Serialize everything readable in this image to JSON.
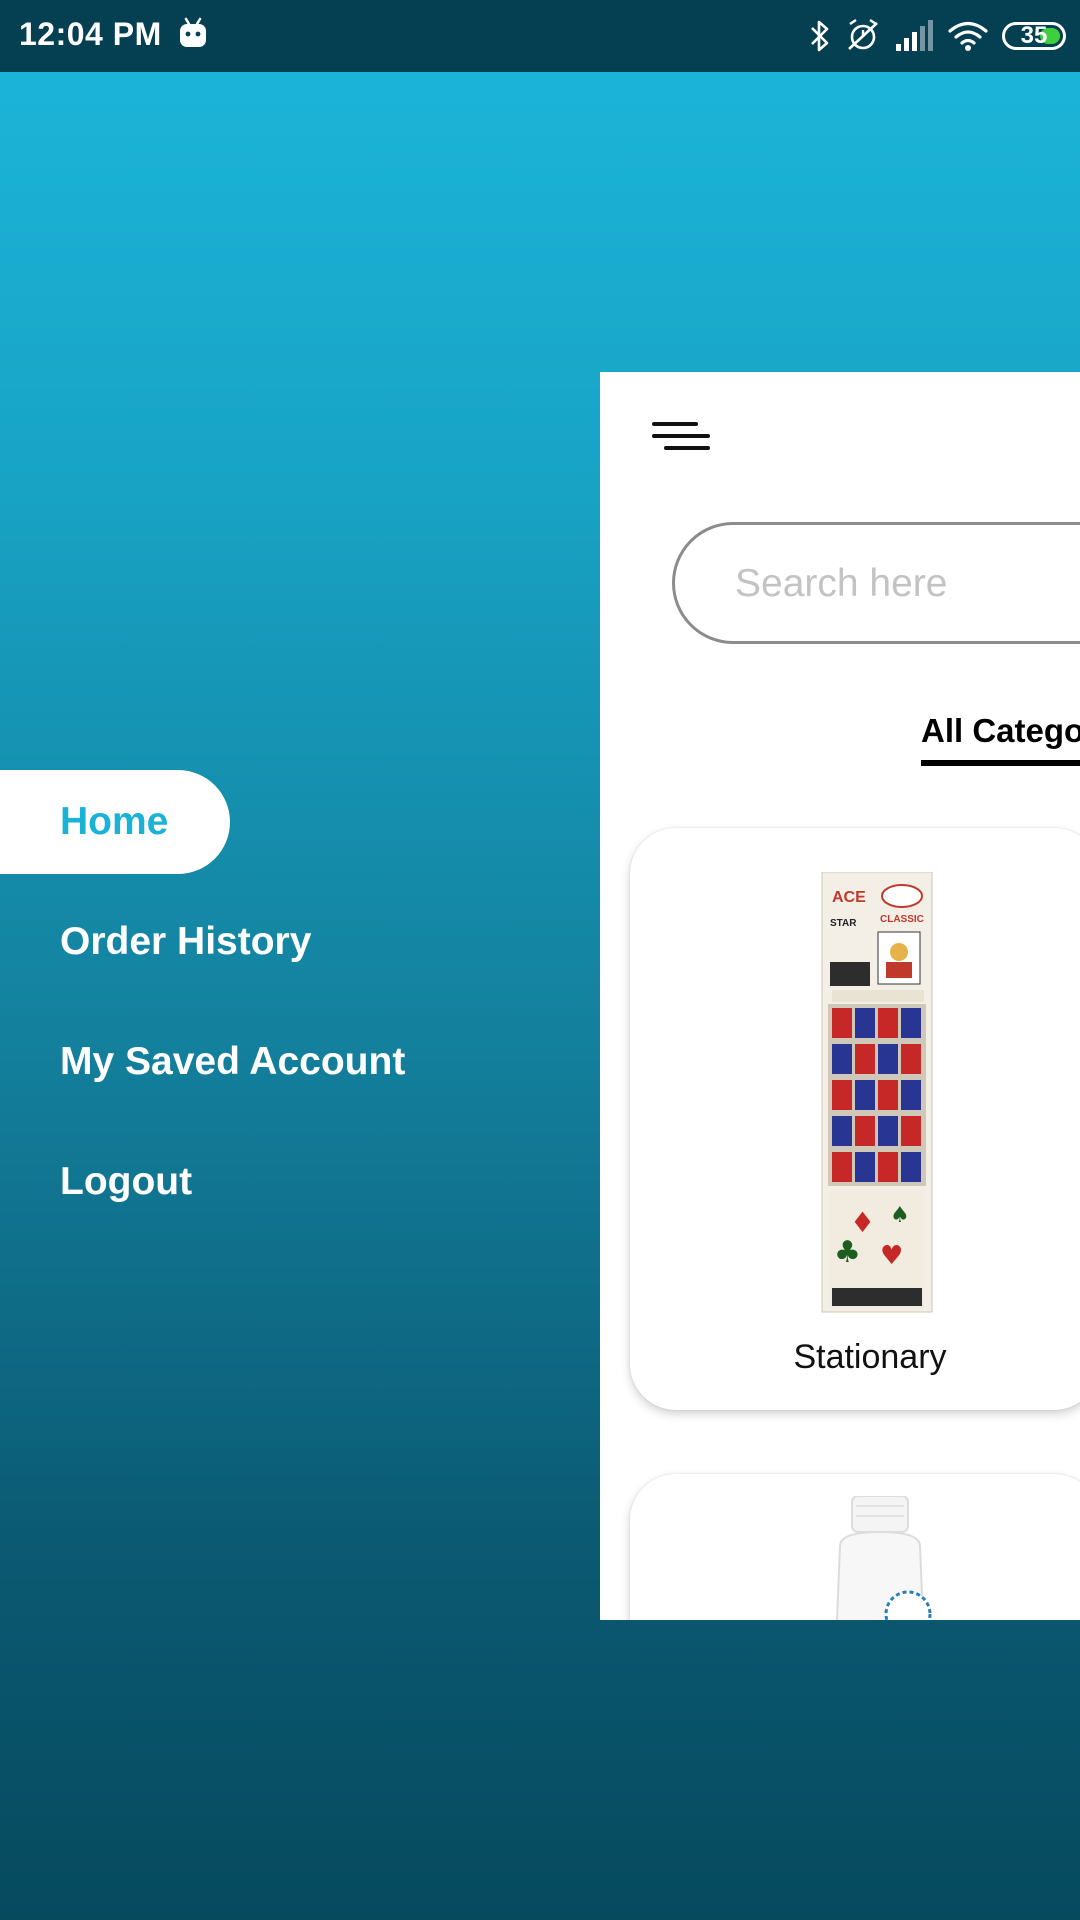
{
  "status_bar": {
    "time": "12:04 PM",
    "battery": "35",
    "icons": [
      "android-icon",
      "bluetooth-icon",
      "alarm-off-icon",
      "signal-icon",
      "wifi-icon",
      "battery-icon"
    ]
  },
  "drawer": {
    "items": [
      {
        "label": "Home",
        "active": true
      },
      {
        "label": "Order History",
        "active": false
      },
      {
        "label": "My Saved Account",
        "active": false
      },
      {
        "label": "Logout",
        "active": false
      }
    ]
  },
  "main": {
    "menu_icon": "hamburger-menu-icon",
    "search": {
      "placeholder": "Search here",
      "value": ""
    },
    "tabs": [
      {
        "label": "All Catego",
        "active": true
      }
    ],
    "categories": [
      {
        "label": "Stationary",
        "image": "playing-cards-display-image"
      },
      {
        "label": "",
        "image": "white-bottle-image"
      }
    ]
  },
  "colors": {
    "status_bar": "#043f52",
    "accent": "#1ab2d6",
    "gradient_top": "#1cb7dc",
    "gradient_bottom": "#064a5e"
  }
}
